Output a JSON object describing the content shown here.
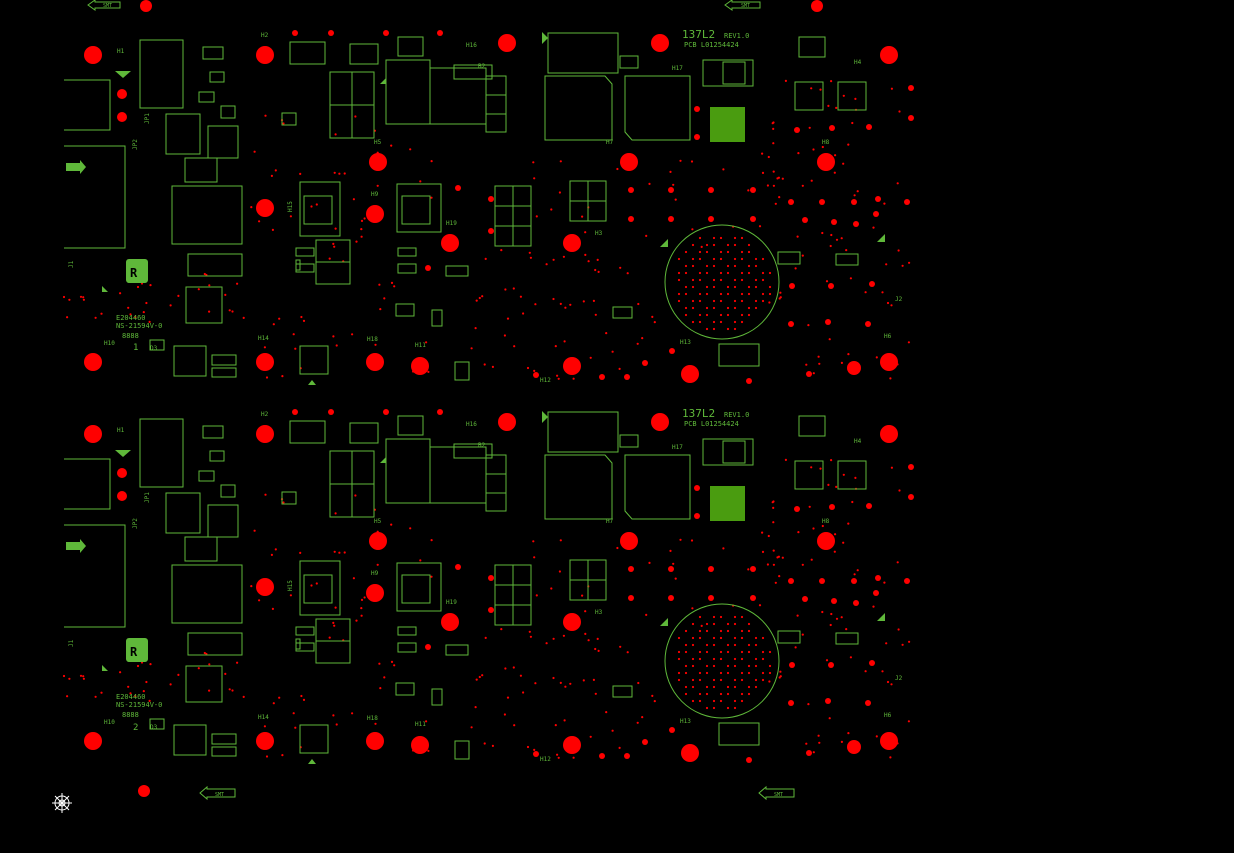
{
  "colors": {
    "background": "#000000",
    "silkscreen": "#5fb83a",
    "pad": "#ff0000",
    "fill": "#4a9c10"
  },
  "panel": {
    "board_title": "137L2",
    "board_rev": "REV1.0",
    "pcb_number": "PCB L01254424",
    "ul_number": "E204460",
    "ul_code": "NS-21594V-0",
    "date_code": "8888",
    "board_index": [
      "1",
      "2"
    ],
    "smt_marker": "SMT",
    "refdes": {
      "h1": "H1",
      "h2": "H2",
      "h3": "H3",
      "h4": "H4",
      "h5": "H5",
      "h6": "H6",
      "h7": "H7",
      "h8": "H8",
      "h9": "H9",
      "h10": "H10",
      "h11": "H11",
      "h12": "H12",
      "h13": "H13",
      "h14": "H14",
      "h15": "H15",
      "h16": "H16",
      "h17": "H17",
      "h18": "H18",
      "h19": "H19",
      "b2": "B2",
      "j1": "J1",
      "j2": "J2",
      "jp1": "JP1",
      "jp2": "JP2",
      "d3": "D3"
    }
  }
}
